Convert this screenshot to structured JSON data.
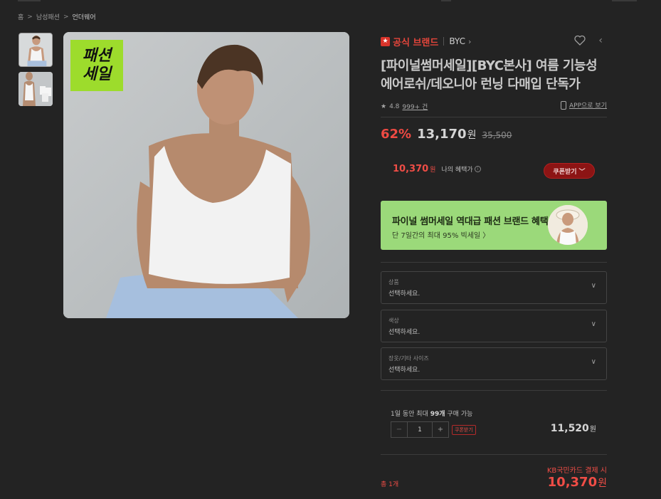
{
  "breadcrumb": {
    "home": "홈",
    "category": "남성패션",
    "current": "언더웨어",
    "sep": ">"
  },
  "image": {
    "badge_line1": "패션",
    "badge_line2": "세일"
  },
  "brand": {
    "official_label": "공식 브랜드",
    "name": "BYC",
    "chevron": "›"
  },
  "product": {
    "title": "[파이널썸머세일][BYC본사] 여름 기능성 에어로쉬/데오니아 런닝 다매입 단독가",
    "rating": "4.8",
    "review_count": "999+ 건",
    "app_link": "APP으로 보기"
  },
  "price": {
    "discount": "62%",
    "sale_price": "13,170",
    "unit": "원",
    "original_price": "35,500"
  },
  "benefit": {
    "amount": "10,370",
    "unit": "원",
    "label": "나의 혜택가",
    "info_icon": "i",
    "coupon_button": "쿠폰받기"
  },
  "promo": {
    "title": "파이널 썸머세일 역대급 패션 브랜드 혜택",
    "subtitle": "단 7일간의 최대 95% 빅세일  〉"
  },
  "options": [
    {
      "label": "상품",
      "value": "선택하세요."
    },
    {
      "label": "색상",
      "value": "선택하세요."
    },
    {
      "label": "장옷/기타 사이즈",
      "value": "선택하세요."
    }
  ],
  "order": {
    "limit_text_1": "1일 동안 최대 ",
    "limit_text_bold": "99개",
    "limit_text_2": " 구매 가능",
    "minus": "−",
    "quantity": "1",
    "plus": "+",
    "coupon_tag": "쿠폰받기",
    "line_price": "11,520",
    "line_unit": "원"
  },
  "summary": {
    "card_note": "KB국민카드 결제 시",
    "total_label": "총 1개",
    "total_price": "10,370",
    "total_unit": "원"
  },
  "colors": {
    "accent_red": "#ef4d46",
    "promo_green": "#9bd97a",
    "badge_green": "#9ddc2c",
    "background": "#232323"
  }
}
